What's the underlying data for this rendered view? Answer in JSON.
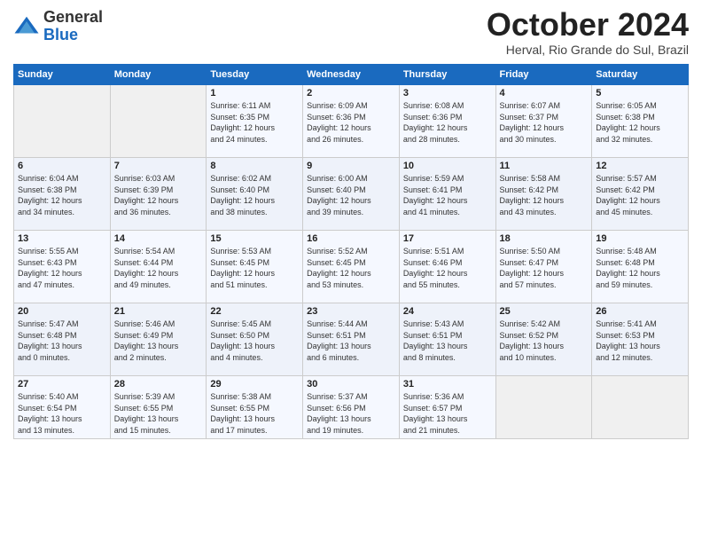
{
  "logo": {
    "general": "General",
    "blue": "Blue"
  },
  "title": "October 2024",
  "location": "Herval, Rio Grande do Sul, Brazil",
  "days_header": [
    "Sunday",
    "Monday",
    "Tuesday",
    "Wednesday",
    "Thursday",
    "Friday",
    "Saturday"
  ],
  "weeks": [
    [
      {
        "day": "",
        "info": ""
      },
      {
        "day": "",
        "info": ""
      },
      {
        "day": "1",
        "info": "Sunrise: 6:11 AM\nSunset: 6:35 PM\nDaylight: 12 hours\nand 24 minutes."
      },
      {
        "day": "2",
        "info": "Sunrise: 6:09 AM\nSunset: 6:36 PM\nDaylight: 12 hours\nand 26 minutes."
      },
      {
        "day": "3",
        "info": "Sunrise: 6:08 AM\nSunset: 6:36 PM\nDaylight: 12 hours\nand 28 minutes."
      },
      {
        "day": "4",
        "info": "Sunrise: 6:07 AM\nSunset: 6:37 PM\nDaylight: 12 hours\nand 30 minutes."
      },
      {
        "day": "5",
        "info": "Sunrise: 6:05 AM\nSunset: 6:38 PM\nDaylight: 12 hours\nand 32 minutes."
      }
    ],
    [
      {
        "day": "6",
        "info": "Sunrise: 6:04 AM\nSunset: 6:38 PM\nDaylight: 12 hours\nand 34 minutes."
      },
      {
        "day": "7",
        "info": "Sunrise: 6:03 AM\nSunset: 6:39 PM\nDaylight: 12 hours\nand 36 minutes."
      },
      {
        "day": "8",
        "info": "Sunrise: 6:02 AM\nSunset: 6:40 PM\nDaylight: 12 hours\nand 38 minutes."
      },
      {
        "day": "9",
        "info": "Sunrise: 6:00 AM\nSunset: 6:40 PM\nDaylight: 12 hours\nand 39 minutes."
      },
      {
        "day": "10",
        "info": "Sunrise: 5:59 AM\nSunset: 6:41 PM\nDaylight: 12 hours\nand 41 minutes."
      },
      {
        "day": "11",
        "info": "Sunrise: 5:58 AM\nSunset: 6:42 PM\nDaylight: 12 hours\nand 43 minutes."
      },
      {
        "day": "12",
        "info": "Sunrise: 5:57 AM\nSunset: 6:42 PM\nDaylight: 12 hours\nand 45 minutes."
      }
    ],
    [
      {
        "day": "13",
        "info": "Sunrise: 5:55 AM\nSunset: 6:43 PM\nDaylight: 12 hours\nand 47 minutes."
      },
      {
        "day": "14",
        "info": "Sunrise: 5:54 AM\nSunset: 6:44 PM\nDaylight: 12 hours\nand 49 minutes."
      },
      {
        "day": "15",
        "info": "Sunrise: 5:53 AM\nSunset: 6:45 PM\nDaylight: 12 hours\nand 51 minutes."
      },
      {
        "day": "16",
        "info": "Sunrise: 5:52 AM\nSunset: 6:45 PM\nDaylight: 12 hours\nand 53 minutes."
      },
      {
        "day": "17",
        "info": "Sunrise: 5:51 AM\nSunset: 6:46 PM\nDaylight: 12 hours\nand 55 minutes."
      },
      {
        "day": "18",
        "info": "Sunrise: 5:50 AM\nSunset: 6:47 PM\nDaylight: 12 hours\nand 57 minutes."
      },
      {
        "day": "19",
        "info": "Sunrise: 5:48 AM\nSunset: 6:48 PM\nDaylight: 12 hours\nand 59 minutes."
      }
    ],
    [
      {
        "day": "20",
        "info": "Sunrise: 5:47 AM\nSunset: 6:48 PM\nDaylight: 13 hours\nand 0 minutes."
      },
      {
        "day": "21",
        "info": "Sunrise: 5:46 AM\nSunset: 6:49 PM\nDaylight: 13 hours\nand 2 minutes."
      },
      {
        "day": "22",
        "info": "Sunrise: 5:45 AM\nSunset: 6:50 PM\nDaylight: 13 hours\nand 4 minutes."
      },
      {
        "day": "23",
        "info": "Sunrise: 5:44 AM\nSunset: 6:51 PM\nDaylight: 13 hours\nand 6 minutes."
      },
      {
        "day": "24",
        "info": "Sunrise: 5:43 AM\nSunset: 6:51 PM\nDaylight: 13 hours\nand 8 minutes."
      },
      {
        "day": "25",
        "info": "Sunrise: 5:42 AM\nSunset: 6:52 PM\nDaylight: 13 hours\nand 10 minutes."
      },
      {
        "day": "26",
        "info": "Sunrise: 5:41 AM\nSunset: 6:53 PM\nDaylight: 13 hours\nand 12 minutes."
      }
    ],
    [
      {
        "day": "27",
        "info": "Sunrise: 5:40 AM\nSunset: 6:54 PM\nDaylight: 13 hours\nand 13 minutes."
      },
      {
        "day": "28",
        "info": "Sunrise: 5:39 AM\nSunset: 6:55 PM\nDaylight: 13 hours\nand 15 minutes."
      },
      {
        "day": "29",
        "info": "Sunrise: 5:38 AM\nSunset: 6:55 PM\nDaylight: 13 hours\nand 17 minutes."
      },
      {
        "day": "30",
        "info": "Sunrise: 5:37 AM\nSunset: 6:56 PM\nDaylight: 13 hours\nand 19 minutes."
      },
      {
        "day": "31",
        "info": "Sunrise: 5:36 AM\nSunset: 6:57 PM\nDaylight: 13 hours\nand 21 minutes."
      },
      {
        "day": "",
        "info": ""
      },
      {
        "day": "",
        "info": ""
      }
    ]
  ]
}
